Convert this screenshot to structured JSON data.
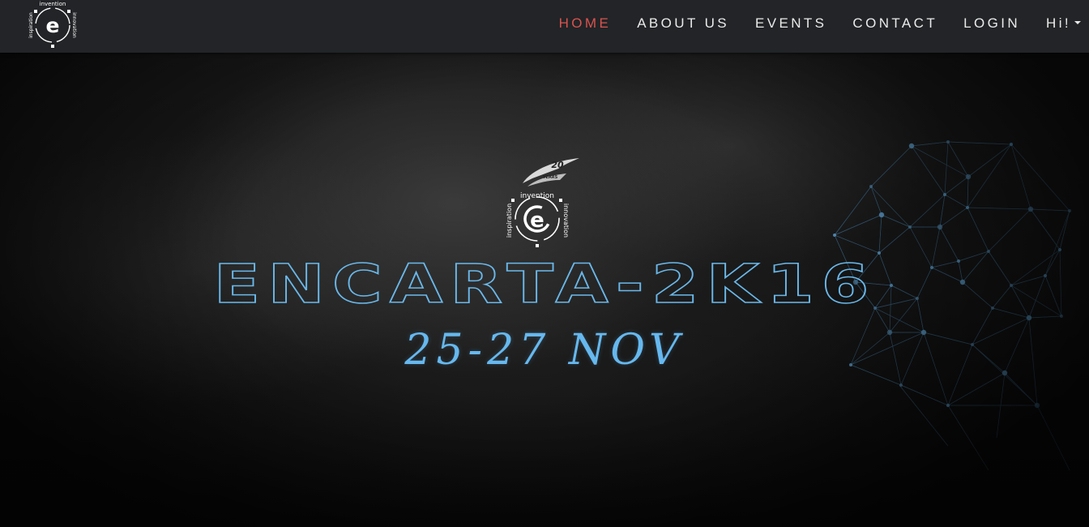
{
  "brand": {
    "logo_word_top": "invention",
    "logo_word_right": "innovation",
    "logo_word_left": "inspiration",
    "logo_letter": "e"
  },
  "nav": {
    "items": [
      {
        "label": "HOME",
        "active": true
      },
      {
        "label": "ABOUT US",
        "active": false
      },
      {
        "label": "EVENTS",
        "active": false
      },
      {
        "label": "CONTACT",
        "active": false
      },
      {
        "label": "LOGIN",
        "active": false
      },
      {
        "label": "Hi!",
        "active": false
      }
    ]
  },
  "hero": {
    "badge_years": "20",
    "badge_years_label": "YEARS",
    "badge_word_top": "invention",
    "badge_word_right": "innovation",
    "badge_word_left": "inspiration",
    "badge_letter": "e",
    "title": "ENCARTA-2K16",
    "date": "25-27 NOV"
  },
  "colors": {
    "accent": "#6ab8ea",
    "nav_active": "#d9534f",
    "navbar_bg": "#222427"
  }
}
